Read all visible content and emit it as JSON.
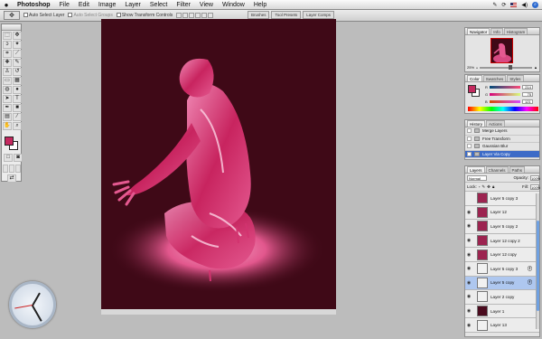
{
  "menubar": {
    "apple": "",
    "items": [
      "Photoshop",
      "File",
      "Edit",
      "Image",
      "Layer",
      "Select",
      "Filter",
      "View",
      "Window",
      "Help"
    ],
    "right_icons": [
      "scripts-icon",
      "sync-icon",
      "flag-us-icon",
      "volume-icon",
      "spotlight-icon"
    ]
  },
  "options": {
    "auto_select_layer": "Auto Select Layer",
    "auto_select_groups": "Auto Select Groups",
    "show_transform": "Show Transform Controls",
    "well_tabs": [
      "Brushes",
      "Tool Presets",
      "Layer Comps"
    ]
  },
  "navigator": {
    "tabs": [
      "Navigator",
      "Info",
      "Histogram"
    ],
    "zoom": "25%"
  },
  "color": {
    "tabs": [
      "Color",
      "Swatches",
      "Styles"
    ],
    "channels": [
      {
        "label": "R",
        "value": "214",
        "color": "#e23c7a"
      },
      {
        "label": "G",
        "value": "75",
        "color": "#52c95a"
      },
      {
        "label": "B",
        "value": "121",
        "color": "#5a6fd9"
      }
    ]
  },
  "history": {
    "tabs": [
      "History",
      "Actions"
    ],
    "items": [
      "Merge Layers",
      "Free Transform",
      "Gaussian Blur",
      "Layer Via Copy"
    ],
    "selected_index": 3
  },
  "layers": {
    "tabs": [
      "Layers",
      "Channels",
      "Paths"
    ],
    "blend_mode": "Normal",
    "opacity_label": "Opacity:",
    "opacity": "100%",
    "lock_label": "Lock:",
    "fill_label": "Fill:",
    "fill": "100%",
    "rows": [
      {
        "name": "Layer 5 copy 3",
        "thumb": "pink",
        "underline": false,
        "fx": false,
        "eye": false
      },
      {
        "name": "Layer 12",
        "thumb": "pink",
        "underline": false,
        "fx": false,
        "eye": true
      },
      {
        "name": "Layer 5 copy 2",
        "thumb": "pink",
        "underline": true,
        "fx": false,
        "eye": true
      },
      {
        "name": "Layer 12 copy 2",
        "thumb": "pink",
        "underline": false,
        "fx": false,
        "eye": true
      },
      {
        "name": "Layer 12 copy",
        "thumb": "pink",
        "underline": false,
        "fx": false,
        "eye": true
      },
      {
        "name": "Layer 5 copy 3",
        "thumb": "light",
        "underline": true,
        "fx": true,
        "eye": true
      },
      {
        "name": "Layer 5 copy",
        "thumb": "light",
        "underline": false,
        "fx": true,
        "eye": true,
        "selected": true
      },
      {
        "name": "Layer 2 copy",
        "thumb": "light",
        "underline": false,
        "fx": false,
        "eye": true
      },
      {
        "name": "Layer 1",
        "thumb": "dark",
        "underline": false,
        "fx": false,
        "eye": true
      },
      {
        "name": "Layer 13",
        "thumb": "light",
        "underline": false,
        "fx": false,
        "eye": true
      }
    ]
  },
  "colors": {
    "canvas_bg": "#3f0917",
    "figure": "#d2336f",
    "glow": "#e85a91",
    "selection": "#aec7ef"
  }
}
